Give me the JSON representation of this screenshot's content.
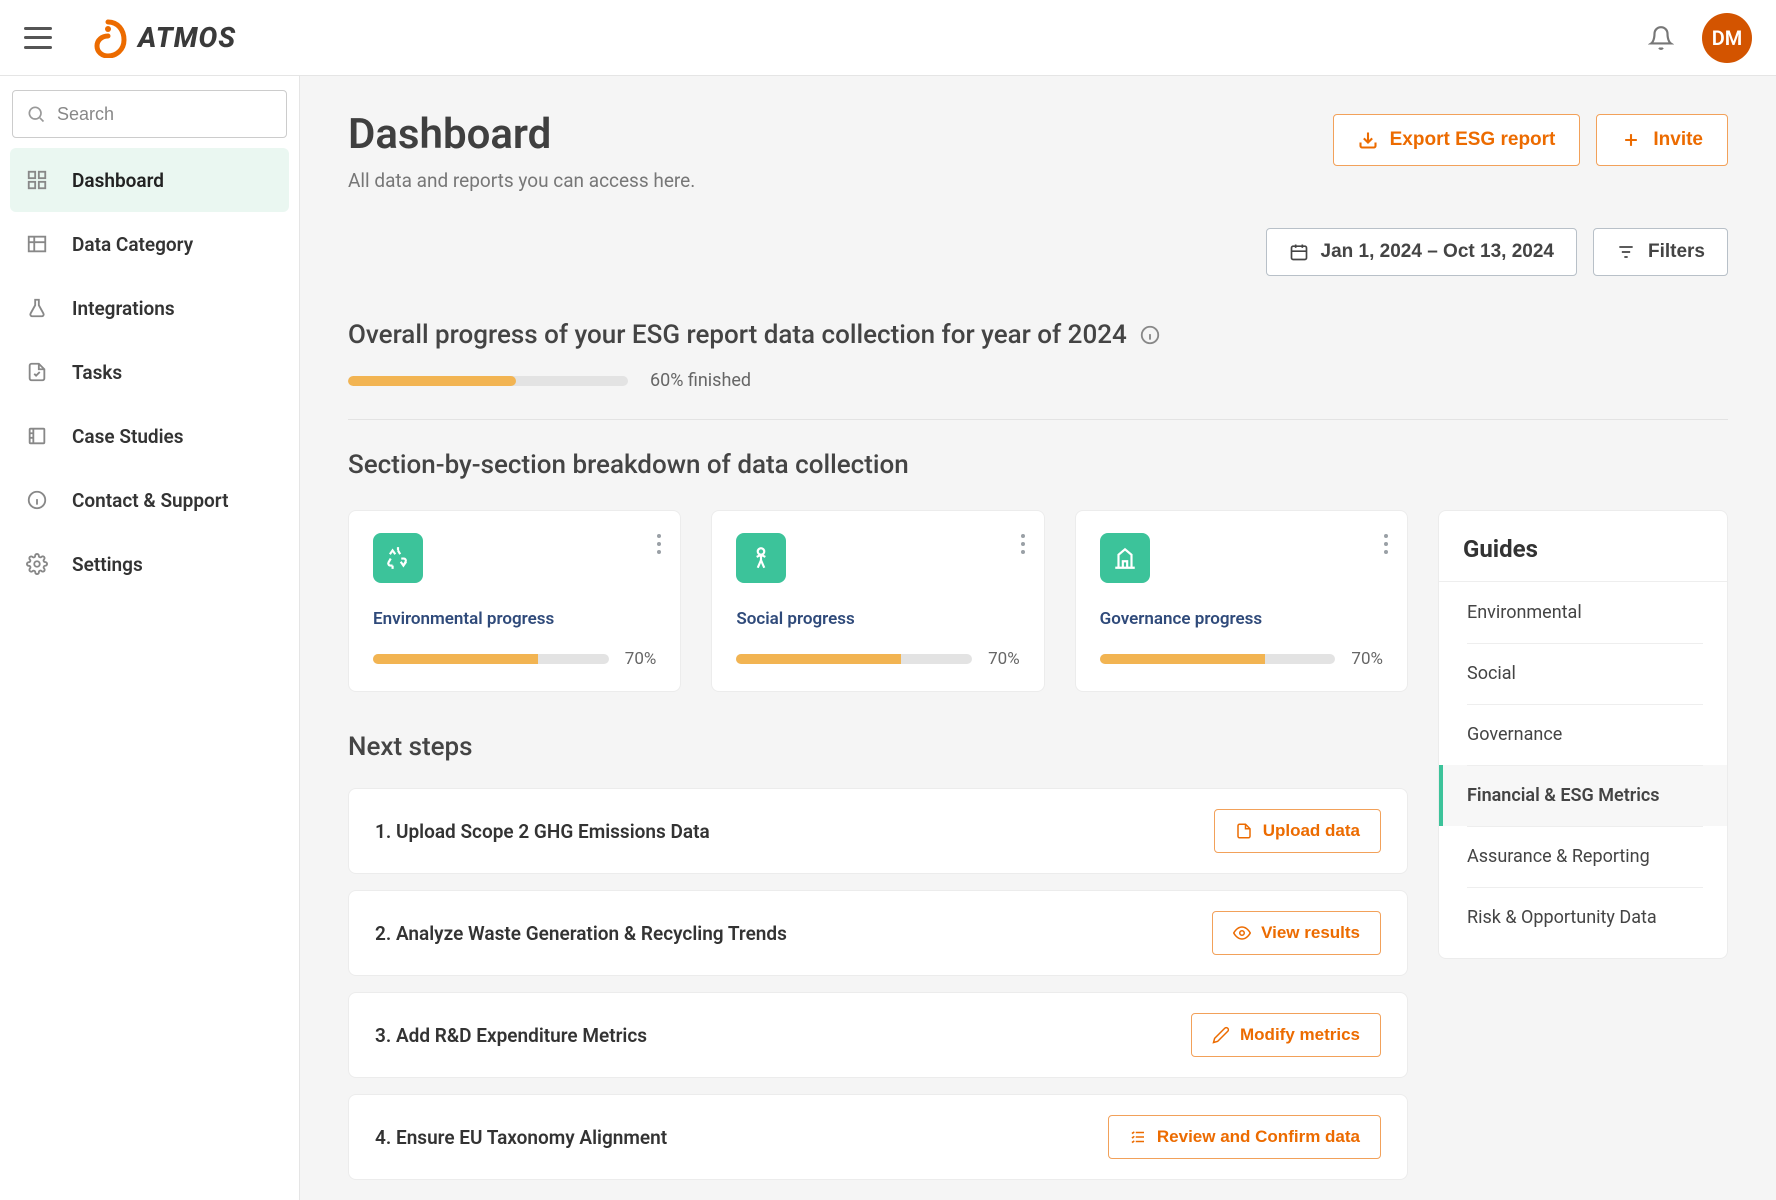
{
  "brand": {
    "name": "ATMOS"
  },
  "user": {
    "initials": "DM"
  },
  "search": {
    "placeholder": "Search"
  },
  "sidebar": {
    "items": [
      {
        "label": "Dashboard",
        "icon": "grid",
        "active": true
      },
      {
        "label": "Data Category",
        "icon": "table",
        "active": false
      },
      {
        "label": "Integrations",
        "icon": "flask",
        "active": false
      },
      {
        "label": "Tasks",
        "icon": "check-file",
        "active": false
      },
      {
        "label": "Case Studies",
        "icon": "book",
        "active": false
      },
      {
        "label": "Contact & Support",
        "icon": "info",
        "active": false
      },
      {
        "label": "Settings",
        "icon": "gear",
        "active": false
      }
    ]
  },
  "header": {
    "title": "Dashboard",
    "subtitle": "All data and reports you can access here.",
    "export_label": "Export ESG report",
    "invite_label": "Invite"
  },
  "filters": {
    "date_range": "Jan 1, 2024 – Oct 13, 2024",
    "filters_label": "Filters"
  },
  "overall": {
    "title": "Overall progress of your ESG report data collection for year of 2024",
    "percent": 60,
    "label": "60% finished"
  },
  "breakdown": {
    "title": "Section-by-section breakdown of data collection",
    "cards": [
      {
        "title": "Environmental progress",
        "percent": 70,
        "label": "70%",
        "icon": "recycle"
      },
      {
        "title": "Social progress",
        "percent": 70,
        "label": "70%",
        "icon": "person"
      },
      {
        "title": "Governance progress",
        "percent": 70,
        "label": "70%",
        "icon": "building"
      }
    ]
  },
  "next_steps": {
    "title": "Next steps",
    "items": [
      {
        "text": "1. Upload Scope 2 GHG Emissions Data",
        "action": "Upload data",
        "icon": "file"
      },
      {
        "text": "2. Analyze Waste Generation & Recycling Trends",
        "action": "View results",
        "icon": "eye"
      },
      {
        "text": "3. Add R&D Expenditure Metrics",
        "action": "Modify metrics",
        "icon": "pencil"
      },
      {
        "text": "4. Ensure EU Taxonomy Alignment",
        "action": "Review and Confirm data",
        "icon": "checklist"
      }
    ]
  },
  "guides": {
    "title": "Guides",
    "items": [
      {
        "label": "Environmental",
        "active": false
      },
      {
        "label": "Social",
        "active": false
      },
      {
        "label": "Governance",
        "active": false
      },
      {
        "label": "Financial & ESG Metrics",
        "active": true
      },
      {
        "label": "Assurance & Reporting",
        "active": false
      },
      {
        "label": "Risk & Opportunity Data",
        "active": false
      }
    ]
  },
  "chart_data": [
    {
      "type": "bar",
      "title": "Overall progress",
      "categories": [
        "Overall"
      ],
      "values": [
        60
      ],
      "ylim": [
        0,
        100
      ],
      "ylabel": "% finished"
    },
    {
      "type": "bar",
      "title": "Section breakdown",
      "categories": [
        "Environmental",
        "Social",
        "Governance"
      ],
      "values": [
        70,
        70,
        70
      ],
      "ylim": [
        0,
        100
      ],
      "ylabel": "%"
    }
  ]
}
